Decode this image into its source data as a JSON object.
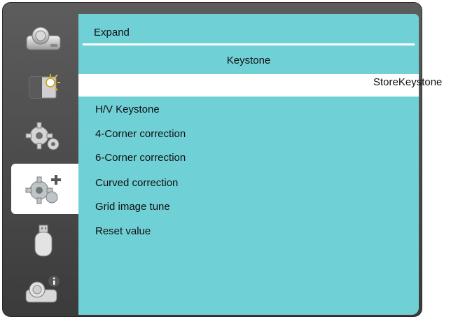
{
  "window": {
    "title": "Expand"
  },
  "section": {
    "title": "Keystone"
  },
  "selected_row": {
    "label": "StoreKeystone"
  },
  "menu": {
    "items": [
      {
        "label": "H/V Keystone"
      },
      {
        "label": "4-Corner correction"
      },
      {
        "label": "6-Corner correction"
      },
      {
        "label": "Curved correction"
      },
      {
        "label": "Grid image tune"
      },
      {
        "label": "Reset value"
      }
    ]
  },
  "sidebar": {
    "tabs": [
      {
        "icon": "projector-icon",
        "active": false
      },
      {
        "icon": "image-brightness-icon",
        "active": false
      },
      {
        "icon": "gear-icon",
        "active": false
      },
      {
        "icon": "expand-gears-icon",
        "active": true
      },
      {
        "icon": "usb-drive-icon",
        "active": false
      },
      {
        "icon": "projector-info-icon",
        "active": false
      }
    ]
  },
  "colors": {
    "panel": "#6fd0d6",
    "frame": "#4a4a4a",
    "highlight": "#ffffff",
    "text": "#111111"
  }
}
